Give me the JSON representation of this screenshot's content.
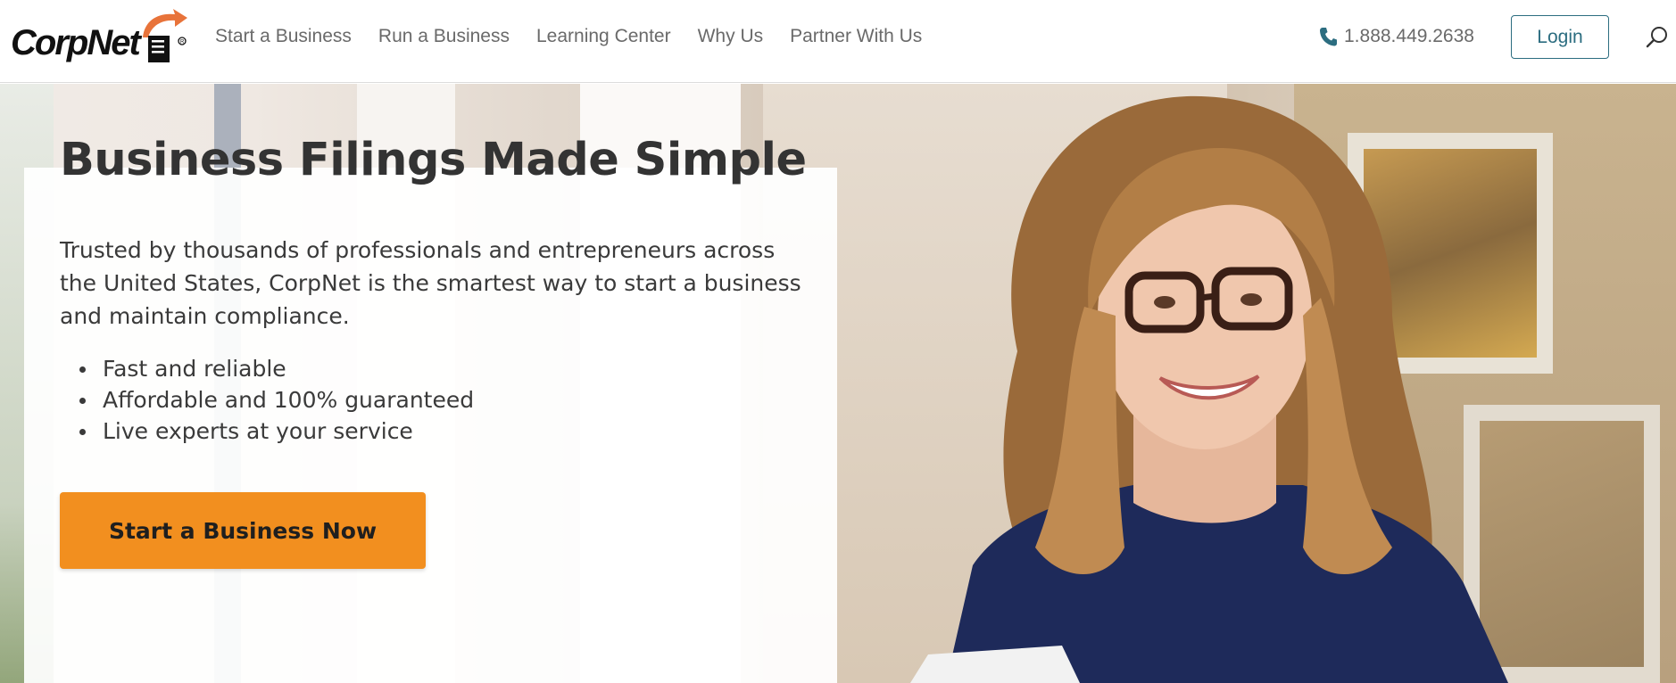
{
  "header": {
    "logo_text": "CorpNet",
    "nav": [
      {
        "label": "Start a Business"
      },
      {
        "label": "Run a Business"
      },
      {
        "label": "Learning Center"
      },
      {
        "label": "Why Us"
      },
      {
        "label": "Partner With Us"
      }
    ],
    "phone": "1.888.449.2638",
    "login_label": "Login",
    "icons": {
      "phone": "phone-icon",
      "search": "search-icon"
    }
  },
  "hero": {
    "title": "Business Filings Made Simple",
    "description": "Trusted by thousands of professionals and entrepreneurs across the United States, CorpNet is the smartest way to start a business and maintain compliance.",
    "bullets": [
      "Fast and reliable",
      "Affordable and 100% guaranteed",
      "Live experts at your service"
    ],
    "cta_label": "Start a Business Now"
  },
  "colors": {
    "accent": "#f28f1f",
    "login_border": "#2c6d80",
    "phone_icon": "#2c6d80",
    "logo_orange": "#e8733a",
    "nav_text": "#6a6a6a",
    "title_text": "#333333"
  }
}
